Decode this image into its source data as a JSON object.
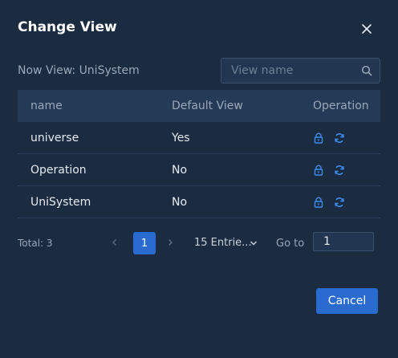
{
  "dialog": {
    "title": "Change View",
    "now_view": "Now View: UniSystem",
    "search_placeholder": "View name",
    "cancel_label": "Cancel"
  },
  "table": {
    "headers": [
      "name",
      "Default View",
      "Operation"
    ],
    "rows": [
      {
        "name": "universe",
        "default": "Yes"
      },
      {
        "name": "Operation",
        "default": "No"
      },
      {
        "name": "UniSystem",
        "default": "No"
      }
    ]
  },
  "pagination": {
    "total": "Total: 3",
    "current_page": "1",
    "page_size": "15 Entrie...",
    "goto_label": "Go to",
    "goto_value": "1"
  },
  "colors": {
    "background": "#1b2b40",
    "accent": "#2a6bcf",
    "header_bg": "#243a57",
    "icon_blue": "#3d8cf0"
  },
  "icons": [
    "close-icon",
    "search-icon",
    "lock-icon",
    "refresh-icon",
    "chevron-left-icon",
    "chevron-right-icon",
    "chevron-down-icon"
  ]
}
